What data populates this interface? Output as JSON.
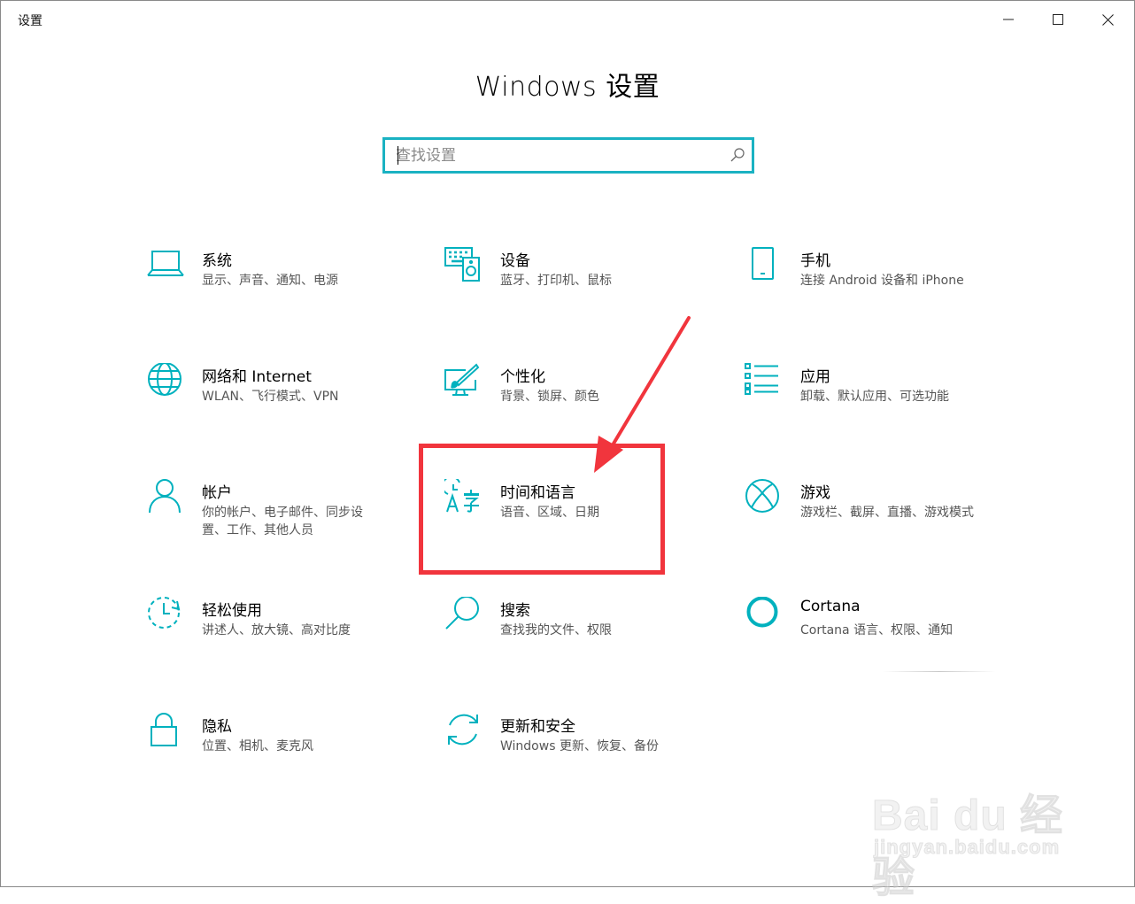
{
  "window": {
    "title": "设置",
    "buttons": {
      "minimize": "minimize-icon",
      "maximize": "maximize-icon",
      "close": "close-icon"
    }
  },
  "page": {
    "title": "Windows 设置"
  },
  "search": {
    "placeholder": "查找设置",
    "value": ""
  },
  "colors": {
    "accent": "#00b1be",
    "highlight": "#f1353d",
    "search_border": "#1ab2c2"
  },
  "tiles": [
    {
      "name": "系统",
      "desc": "显示、声音、通知、电源",
      "icon": "laptop-icon"
    },
    {
      "name": "设备",
      "desc": "蓝牙、打印机、鼠标",
      "icon": "keyboard-speaker-icon"
    },
    {
      "name": "手机",
      "desc": "连接 Android 设备和 iPhone",
      "icon": "phone-icon"
    },
    {
      "name": "网络和 Internet",
      "desc": "WLAN、飞行模式、VPN",
      "icon": "globe-icon"
    },
    {
      "name": "个性化",
      "desc": "背景、锁屏、颜色",
      "icon": "paint-monitor-icon"
    },
    {
      "name": "应用",
      "desc": "卸载、默认应用、可选功能",
      "icon": "app-list-icon"
    },
    {
      "name": "帐户",
      "desc": "你的帐户、电子邮件、同步设置、工作、其他人员",
      "icon": "person-icon"
    },
    {
      "name": "时间和语言",
      "desc": "语音、区域、日期",
      "icon": "time-language-icon"
    },
    {
      "name": "游戏",
      "desc": "游戏栏、截屏、直播、游戏模式",
      "icon": "xbox-icon"
    },
    {
      "name": "轻松使用",
      "desc": "讲述人、放大镜、高对比度",
      "icon": "ease-of-access-icon"
    },
    {
      "name": "搜索",
      "desc": "查找我的文件、权限",
      "icon": "search-magnifier-icon"
    },
    {
      "name": "Cortana",
      "desc": "Cortana 语言、权限、通知",
      "icon": "cortana-ring-icon"
    },
    {
      "name": "隐私",
      "desc": "位置、相机、麦克风",
      "icon": "lock-icon"
    },
    {
      "name": "更新和安全",
      "desc": "Windows 更新、恢复、备份",
      "icon": "sync-arrows-icon"
    }
  ],
  "annotation": {
    "highlighted_tile": "时间和语言",
    "shape": "red-box-with-arrow"
  },
  "watermark": {
    "brand": "Bai du 经验",
    "url": "jingyan.baidu.com"
  }
}
